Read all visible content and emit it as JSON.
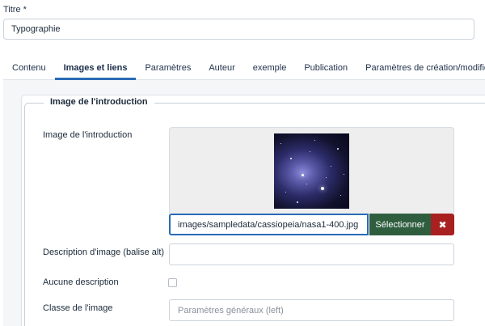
{
  "title_field": {
    "label": "Titre *",
    "value": "Typographie"
  },
  "tabs": [
    {
      "label": "Contenu",
      "active": false
    },
    {
      "label": "Images et liens",
      "active": true
    },
    {
      "label": "Paramètres",
      "active": false
    },
    {
      "label": "Auteur",
      "active": false
    },
    {
      "label": "exemple",
      "active": false
    },
    {
      "label": "Publication",
      "active": false
    },
    {
      "label": "Paramètres de création/modification",
      "active": false
    }
  ],
  "section": {
    "legend": "Image de l'introduction",
    "intro_image": {
      "label": "Image de l'introduction",
      "path": "images/sampledata/cassiopeia/nasa1-400.jpg",
      "select_label": "Sélectionner",
      "clear_icon": "close-icon"
    },
    "alt_text": {
      "label": "Description d'image (balise alt)",
      "value": ""
    },
    "no_description": {
      "label": "Aucune description",
      "checked": false
    },
    "image_class": {
      "label": "Classe de l'image",
      "placeholder": "Paramètres généraux (left)"
    }
  },
  "colors": {
    "accent": "#2a6bb5",
    "select_button": "#2f5e3f",
    "clear_button": "#a82020"
  }
}
